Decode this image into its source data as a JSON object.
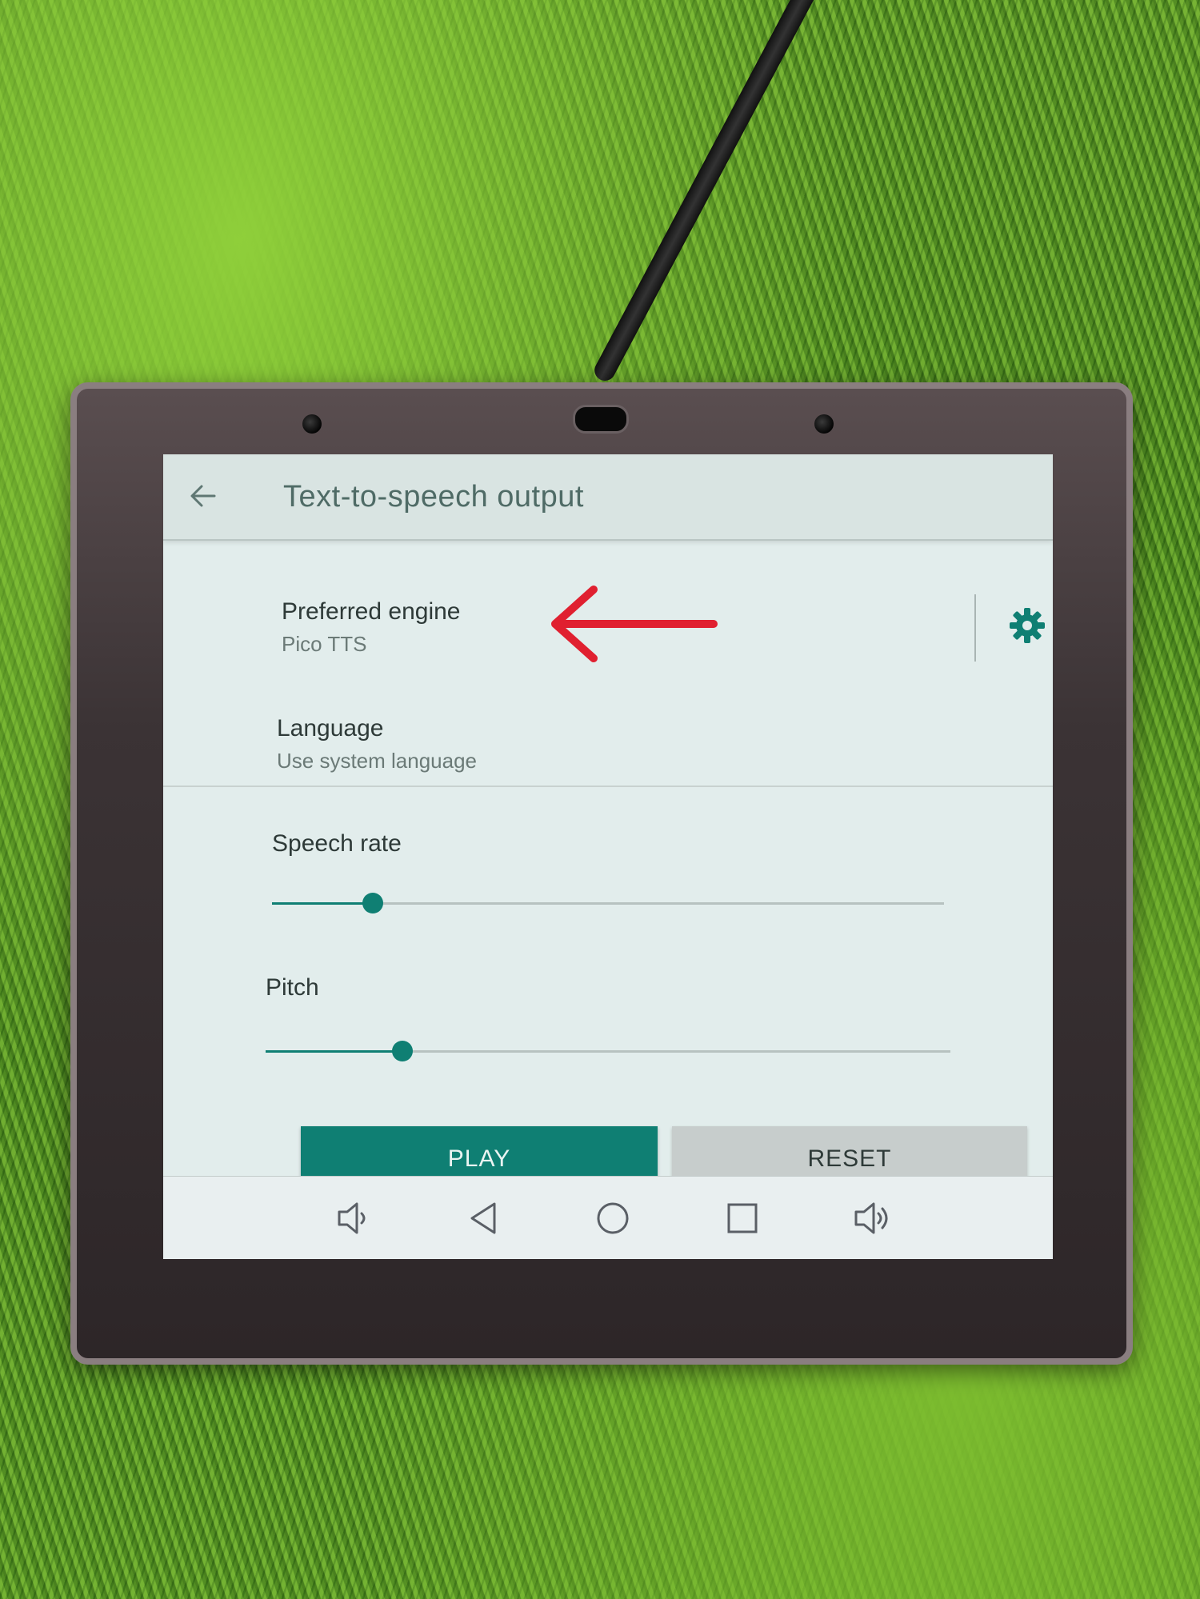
{
  "app_bar": {
    "title": "Text-to-speech output",
    "back_icon": "arrow-left-icon"
  },
  "preferences": {
    "engine": {
      "title": "Preferred engine",
      "value": "Pico TTS",
      "settings_icon": "gear-icon"
    },
    "language": {
      "title": "Language",
      "value": "Use system language"
    },
    "speech_rate": {
      "label": "Speech rate",
      "level": 0.15
    },
    "pitch": {
      "label": "Pitch",
      "level": 0.2
    }
  },
  "buttons": {
    "play": "PLAY",
    "reset": "RESET"
  },
  "nav_bar": {
    "icons": [
      "volume-down-icon",
      "back-triangle-icon",
      "home-circle-icon",
      "recents-square-icon",
      "volume-up-icon"
    ]
  },
  "colors": {
    "accent": "#0f7f73",
    "annotation_arrow": "#e02030"
  }
}
